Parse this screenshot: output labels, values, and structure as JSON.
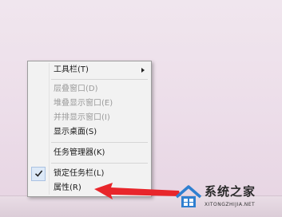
{
  "menu": {
    "items": [
      {
        "label": "工具栏(T)",
        "enabled": true,
        "has_submenu": true
      },
      {
        "label": "层叠窗口(D)",
        "enabled": false
      },
      {
        "label": "堆叠显示窗口(E)",
        "enabled": false
      },
      {
        "label": "并排显示窗口(I)",
        "enabled": false
      },
      {
        "label": "显示桌面(S)",
        "enabled": true
      },
      {
        "label": "任务管理器(K)",
        "enabled": true
      },
      {
        "label": "锁定任务栏(L)",
        "enabled": true,
        "checked": true
      },
      {
        "label": "属性(R)",
        "enabled": true
      }
    ]
  },
  "annotation": {
    "arrow_color": "#e8262b",
    "points_to": "属性(R)"
  },
  "watermark": {
    "name": "系统之家",
    "url": "XITONGZHIJIA.NET"
  },
  "colors": {
    "desktop": "#ecdde9",
    "menu_background": "#f2f2f2",
    "disabled_text": "#9a9a9a",
    "logo_blue": "#2f7fd0"
  }
}
